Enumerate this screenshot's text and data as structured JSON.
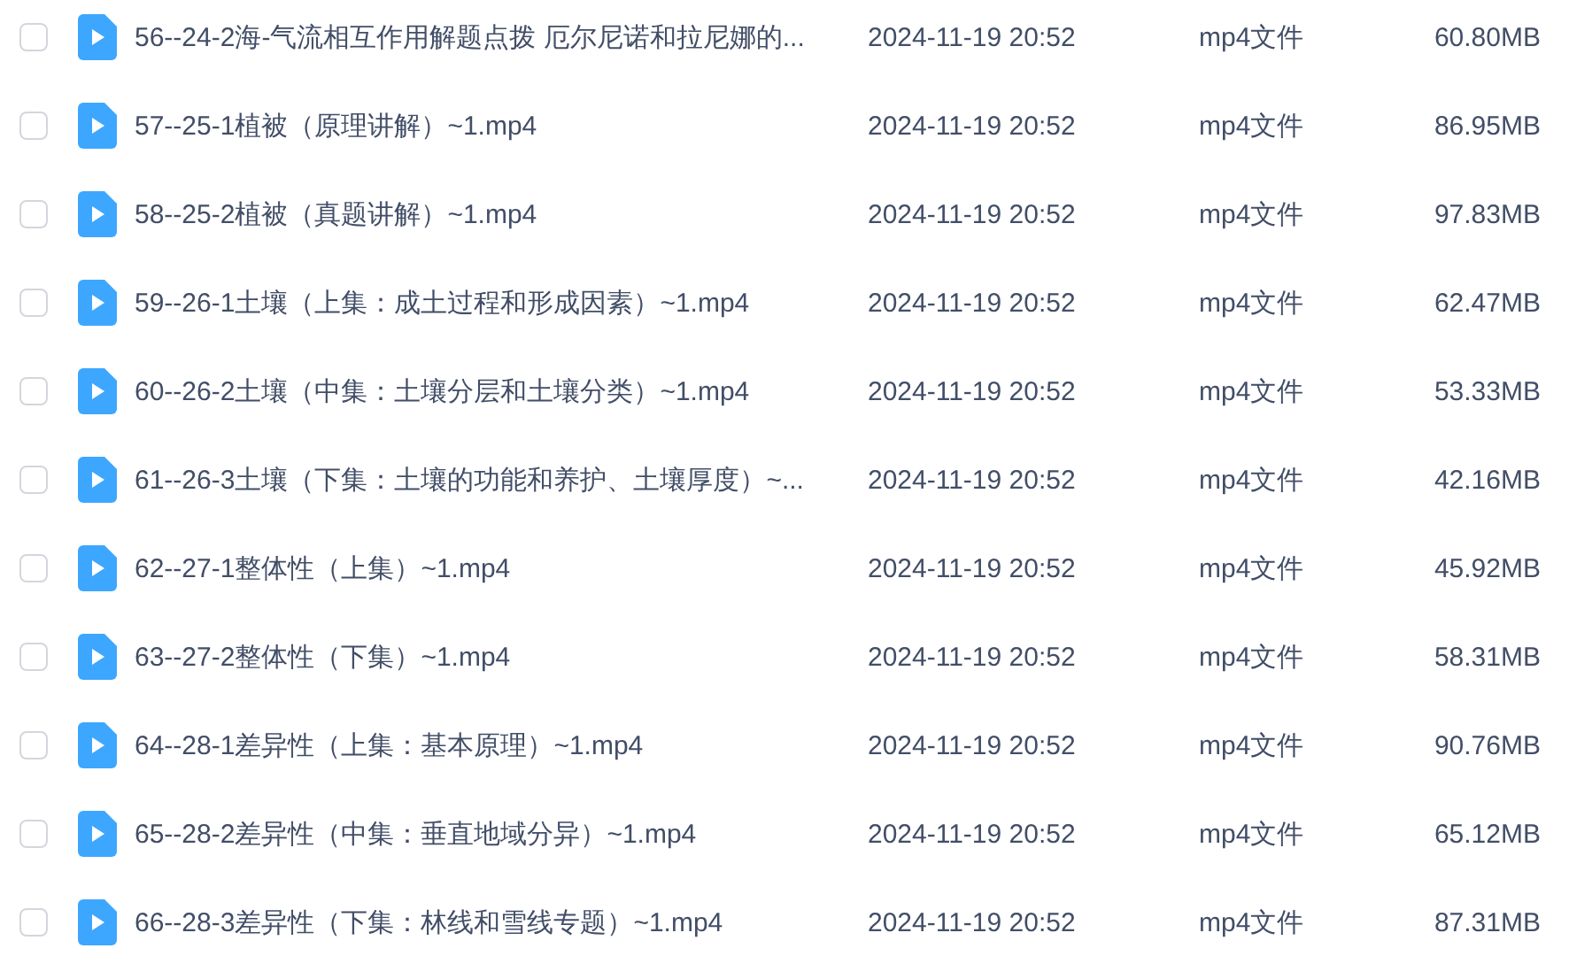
{
  "files": [
    {
      "checked": false,
      "name": "56--24-2海-气流相互作用解题点拨 厄尔尼诺和拉尼娜的...",
      "modified": "2024-11-19 20:52",
      "type": "mp4文件",
      "size": "60.80MB"
    },
    {
      "checked": false,
      "name": "57--25-1植被（原理讲解）~1.mp4",
      "modified": "2024-11-19 20:52",
      "type": "mp4文件",
      "size": "86.95MB"
    },
    {
      "checked": false,
      "name": "58--25-2植被（真题讲解）~1.mp4",
      "modified": "2024-11-19 20:52",
      "type": "mp4文件",
      "size": "97.83MB"
    },
    {
      "checked": false,
      "name": "59--26-1土壤（上集：成土过程和形成因素）~1.mp4",
      "modified": "2024-11-19 20:52",
      "type": "mp4文件",
      "size": "62.47MB"
    },
    {
      "checked": false,
      "name": "60--26-2土壤（中集：土壤分层和土壤分类）~1.mp4",
      "modified": "2024-11-19 20:52",
      "type": "mp4文件",
      "size": "53.33MB"
    },
    {
      "checked": false,
      "name": "61--26-3土壤（下集：土壤的功能和养护、土壤厚度）~...",
      "modified": "2024-11-19 20:52",
      "type": "mp4文件",
      "size": "42.16MB"
    },
    {
      "checked": false,
      "name": "62--27-1整体性（上集）~1.mp4",
      "modified": "2024-11-19 20:52",
      "type": "mp4文件",
      "size": "45.92MB"
    },
    {
      "checked": false,
      "name": "63--27-2整体性（下集）~1.mp4",
      "modified": "2024-11-19 20:52",
      "type": "mp4文件",
      "size": "58.31MB"
    },
    {
      "checked": false,
      "name": "64--28-1差异性（上集：基本原理）~1.mp4",
      "modified": "2024-11-19 20:52",
      "type": "mp4文件",
      "size": "90.76MB"
    },
    {
      "checked": false,
      "name": "65--28-2差异性（中集：垂直地域分异）~1.mp4",
      "modified": "2024-11-19 20:52",
      "type": "mp4文件",
      "size": "65.12MB"
    },
    {
      "checked": false,
      "name": "66--28-3差异性（下集：林线和雪线专题）~1.mp4",
      "modified": "2024-11-19 20:52",
      "type": "mp4文件",
      "size": "87.31MB"
    }
  ]
}
